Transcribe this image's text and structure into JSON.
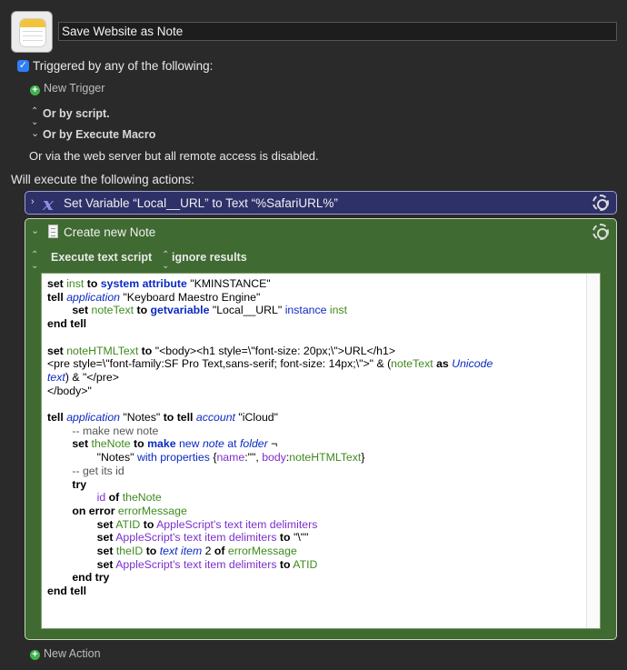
{
  "macro": {
    "name": "Save Website as Note"
  },
  "triggers": {
    "header": "Triggered by any of the following:",
    "new_trigger": "New Trigger",
    "or_by_script": "Or by script.",
    "or_by_execute_macro": "Or by Execute Macro",
    "web_server_note": "Or via the web server but all remote access is disabled."
  },
  "actions_header": "Will execute the following actions:",
  "actions": [
    {
      "label": "Set Variable “Local__URL” to Text “%SafariURL%”",
      "color": "#2e3168"
    },
    {
      "label": "Create new Note",
      "color": "#3f6a31",
      "execute_option": "Execute text script",
      "results_option": "ignore results"
    }
  ],
  "new_action": "New Action",
  "colors": {
    "background": "#2a2a2a",
    "checkbox_blue": "#2f7ff6",
    "add_green": "#3fb34f"
  }
}
